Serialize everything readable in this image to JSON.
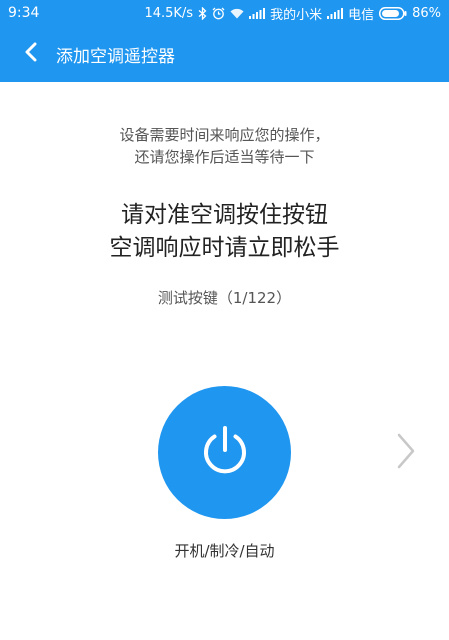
{
  "status_bar": {
    "time": "9:34",
    "network_speed": "14.5K/s",
    "carrier1": "我的小米",
    "carrier2": "电信",
    "battery": "86%",
    "icons": [
      "bluetooth-icon",
      "alarm-icon",
      "wifi-icon",
      "signal-icon",
      "battery-icon"
    ]
  },
  "header": {
    "title": "添加空调遥控器",
    "back_icon": "chevron-left-icon"
  },
  "main": {
    "hint_line1": "设备需要时间来响应您的操作，",
    "hint_line2": "还请您操作后适当等待一下",
    "instruction_line1": "请对准空调按住按钮",
    "instruction_line2": "空调响应时请立即松手",
    "progress": "测试按键（1/122）",
    "power_icon": "power-icon",
    "next_icon": "chevron-right-icon",
    "key_label": "开机/制冷/自动"
  },
  "colors": {
    "accent": "#1f96f0",
    "chevron_gray": "#c8c8c8"
  }
}
